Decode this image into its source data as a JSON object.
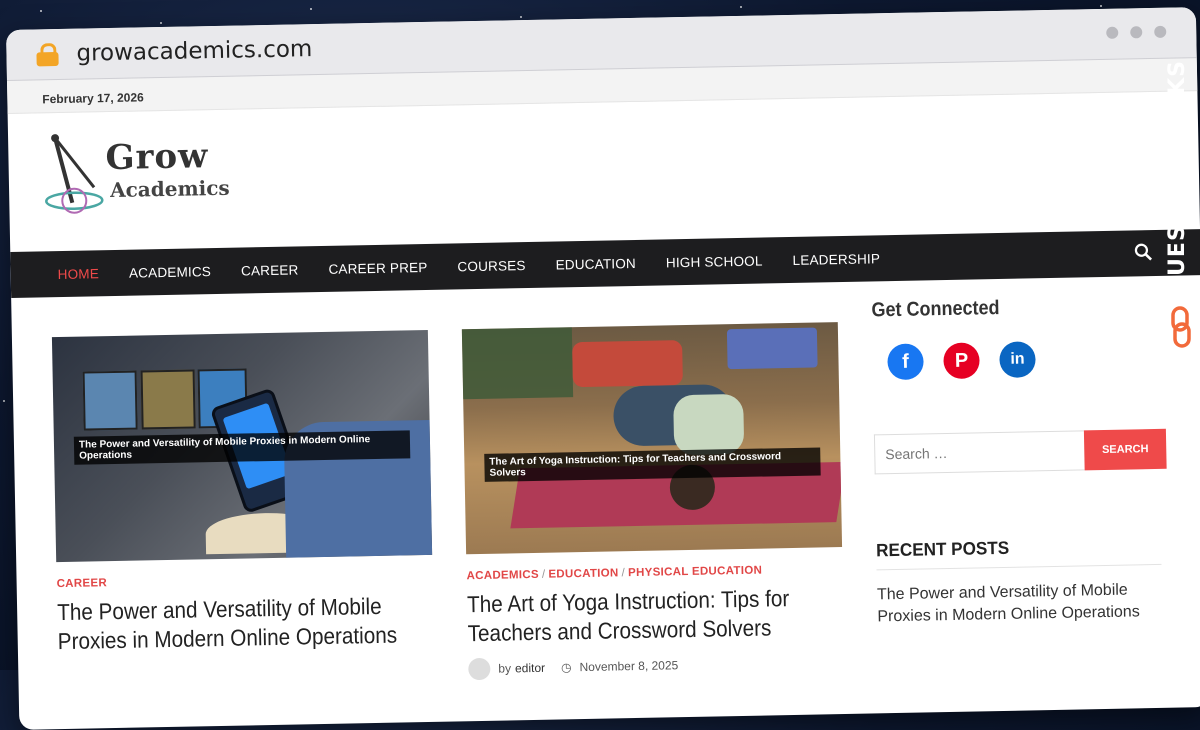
{
  "browser": {
    "url": "growacademics.com",
    "date": "February 17, 2026"
  },
  "logo": {
    "line1": "Grow",
    "line2": "Academics"
  },
  "nav": {
    "items": [
      "HOME",
      "ACADEMICS",
      "CAREER",
      "CAREER PREP",
      "COURSES",
      "EDUCATION",
      "HIGH SCHOOL",
      "LEADERSHIP"
    ],
    "active_index": 0
  },
  "posts": [
    {
      "image_caption": "The Power and Versatility of Mobile Proxies in Modern Online Operations",
      "categories": [
        "CAREER"
      ],
      "title": "The Power and Versatility of Mobile Proxies in Modern Online Operations",
      "date": ""
    },
    {
      "image_caption": "The Art of Yoga Instruction: Tips for Teachers and Crossword Solvers",
      "categories": [
        "ACADEMICS",
        "EDUCATION",
        "PHYSICAL EDUCATION"
      ],
      "title": "The Art of Yoga Instruction: Tips for Teachers and Crossword Solvers",
      "author_prefix": "by",
      "author": "editor",
      "date": "November 8, 2025"
    }
  ],
  "sidebar": {
    "connected_title": "Get Connected",
    "social": [
      "facebook-icon",
      "pinterest-icon",
      "linkedin-icon"
    ],
    "search_placeholder": "Search …",
    "search_button": "SEARCH",
    "recent_title": "RECENT POSTS",
    "recent_items": [
      "The Power and Versatility of Mobile Proxies in Modern Online Operations"
    ]
  },
  "watermark": "GUESTPOSTLINKS",
  "colors": {
    "accent": "#ef4a4a",
    "nav_bg": "#1d1d1f",
    "facebook": "#1877f2",
    "pinterest": "#e60023",
    "linkedin": "#0a66c2"
  }
}
